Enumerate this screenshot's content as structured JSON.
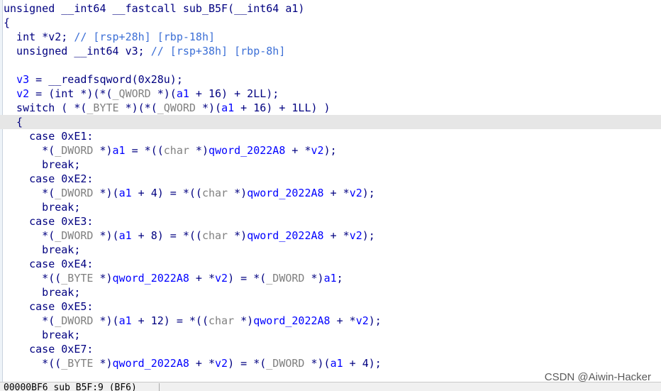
{
  "code": {
    "l01": [
      "unsigned __int64 __fastcall sub_B5F(__int64 a1)"
    ],
    "l02": [
      "{"
    ],
    "l03": [
      "  int *v2; ",
      "// [rsp+28h] [rbp-18h]"
    ],
    "l04": [
      "  unsigned __int64 v3; ",
      "// [rsp+38h] [rbp-8h]"
    ],
    "l05": [
      ""
    ],
    "l06": [
      "  ",
      "v3",
      " = __readfsqword(0x28u);"
    ],
    "l07": [
      "  ",
      "v2",
      " = (int *)(*(",
      "_QWORD",
      " *)(",
      "a1",
      " + 16) + 2LL);"
    ],
    "l08": [
      "  switch ( *(",
      "_BYTE",
      " *)(*(",
      "_QWORD",
      " *)(",
      "a1",
      " + 16) + 1LL) )"
    ],
    "l09": [
      "  {"
    ],
    "l10": [
      "    case 0xE1:"
    ],
    "l11": [
      "      *(",
      "_DWORD",
      " *)",
      "a1",
      " = *((",
      "char",
      " *)",
      "qword_2022A8",
      " + *",
      "v2",
      ");"
    ],
    "l12": [
      "      break;"
    ],
    "l13": [
      "    case 0xE2:"
    ],
    "l14": [
      "      *(",
      "_DWORD",
      " *)(",
      "a1",
      " + 4) = *((",
      "char",
      " *)",
      "qword_2022A8",
      " + *",
      "v2",
      ");"
    ],
    "l15": [
      "      break;"
    ],
    "l16": [
      "    case 0xE3:"
    ],
    "l17": [
      "      *(",
      "_DWORD",
      " *)(",
      "a1",
      " + 8) = *((",
      "char",
      " *)",
      "qword_2022A8",
      " + *",
      "v2",
      ");"
    ],
    "l18": [
      "      break;"
    ],
    "l19": [
      "    case 0xE4:"
    ],
    "l20": [
      "      *((",
      "_BYTE",
      " *)",
      "qword_2022A8",
      " + *",
      "v2",
      ") = *(",
      "_DWORD",
      " *)",
      "a1",
      ";"
    ],
    "l21": [
      "      break;"
    ],
    "l22": [
      "    case 0xE5:"
    ],
    "l23": [
      "      *(",
      "_DWORD",
      " *)(",
      "a1",
      " + 12) = *((",
      "char",
      " *)",
      "qword_2022A8",
      " + *",
      "v2",
      ");"
    ],
    "l24": [
      "      break;"
    ],
    "l25": [
      "    case 0xE7:"
    ],
    "l26": [
      "      *((",
      "_BYTE",
      " *)",
      "qword_2022A8",
      " + *",
      "v2",
      ") = *(",
      "_DWORD",
      " *)(",
      "a1",
      " + 4);"
    ]
  },
  "status": {
    "text": "00000BF6 sub_B5F:9 (BF6)"
  },
  "watermark": "CSDN @Aiwin-Hacker",
  "colors": {
    "keyword": "#000080",
    "identifier": "#0000ff",
    "type": "#808080",
    "comment": "#3c6fd6",
    "highlight": "#e6e6e6"
  }
}
